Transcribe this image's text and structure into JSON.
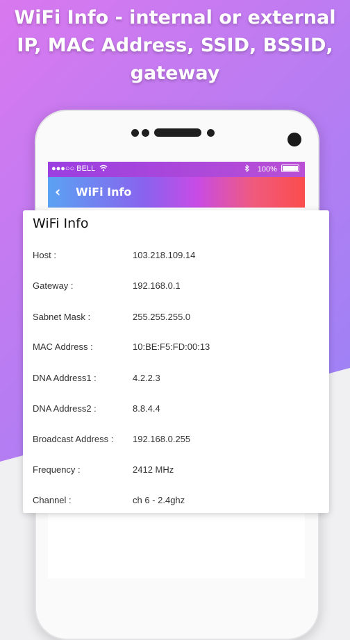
{
  "headline": {
    "line1": "WiFi Info - internal or external",
    "line2": "IP, MAC Address, SSID, BSSID,",
    "line3": "gateway"
  },
  "status_bar": {
    "carrier": "●●●○○ BELL",
    "wifi_icon": "wifi-icon",
    "bluetooth_icon": "bluetooth-icon",
    "battery_text": "100%"
  },
  "app_bar": {
    "back_icon": "back-arrow-icon",
    "title": "WiFi Info"
  },
  "card": {
    "title": "WiFi Info",
    "rows": [
      {
        "label": "Host :",
        "value": "103.218.109.14"
      },
      {
        "label": "Gateway :",
        "value": "192.168.0.1"
      },
      {
        "label": "Sabnet Mask :",
        "value": "255.255.255.0"
      },
      {
        "label": "MAC Address :",
        "value": "10:BE:F5:FD:00:13"
      },
      {
        "label": "DNA Address1 :",
        "value": "4.2.2.3"
      },
      {
        "label": "DNA Address2 :",
        "value": "8.8.4.4"
      },
      {
        "label": "Broadcast Address :",
        "value": "192.168.0.255"
      },
      {
        "label": "Frequency :",
        "value": "2412 MHz"
      },
      {
        "label": "Channel :",
        "value": "ch 6 - 2.4ghz"
      }
    ]
  },
  "colors": {
    "background_gradient_start": "#d978ef",
    "background_gradient_end": "#8c86f7",
    "appbar_gradient_start": "#5aa2f3",
    "appbar_gradient_end": "#fb4d4d"
  }
}
